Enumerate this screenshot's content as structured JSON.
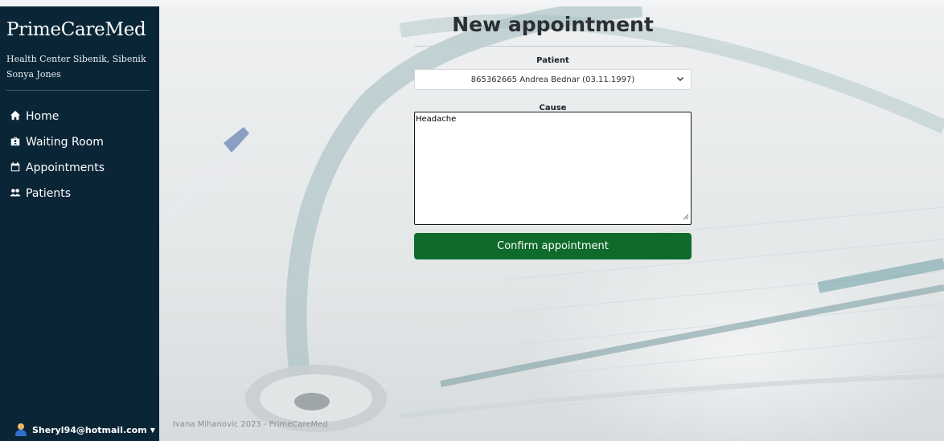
{
  "sidebar": {
    "brand": "PrimeCareMed",
    "health_center": "Health Center Sibenik, Sibenik",
    "user_name": "Sonya Jones",
    "items": [
      {
        "label": "Home",
        "icon": "home-icon"
      },
      {
        "label": "Waiting Room",
        "icon": "waiting-room-icon"
      },
      {
        "label": "Appointments",
        "icon": "calendar-icon"
      },
      {
        "label": "Patients",
        "icon": "users-icon"
      }
    ],
    "account_email": "Sheryl94@hotmail.com",
    "background_color": "#0a2536"
  },
  "form": {
    "title": "New appointment",
    "patient_label": "Patient",
    "patient_selected": "865362665 Andrea Bednar (03.11.1997)",
    "cause_label": "Cause",
    "cause_value": "Headache",
    "confirm_label": "Confirm appointment",
    "confirm_color": "#0f6b2c"
  },
  "footer": {
    "text": "Ivana Mihanovic 2023 - PrimeCareMed"
  }
}
